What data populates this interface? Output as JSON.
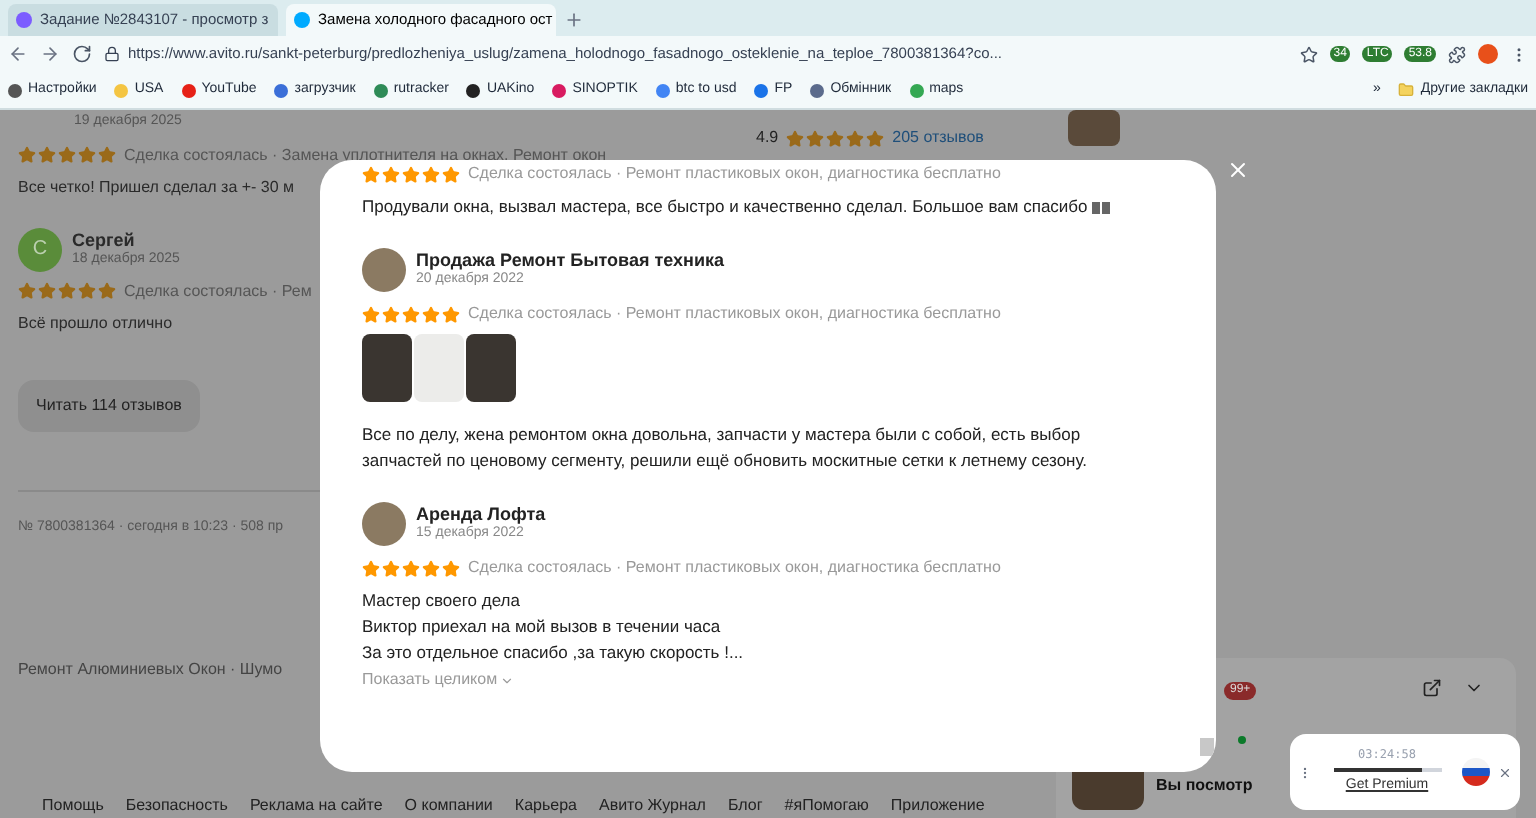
{
  "browser": {
    "tabs": [
      {
        "title": "Задание №2843107 - просмотр з",
        "selected": false
      },
      {
        "title": "Замена холодного фасадного ост",
        "selected": true
      }
    ],
    "url": "https://www.avito.ru/sankt-peterburg/predlozheniya_uslug/zamena_holodnogo_fasadnogo_osteklenie_na_teploe_7800381364?co...",
    "extension_badges": [
      "34",
      "LTC",
      "53.8"
    ],
    "bookmarks": [
      {
        "label": "Настройки",
        "color": "#555555"
      },
      {
        "label": "USA",
        "color": "#f4c542"
      },
      {
        "label": "YouTube",
        "color": "#e62117"
      },
      {
        "label": "загрузчик",
        "color": "#3b6fd8"
      },
      {
        "label": "rutracker",
        "color": "#2e8b57"
      },
      {
        "label": "UAKino",
        "color": "#222222"
      },
      {
        "label": "SINOPTIK",
        "color": "#d81b60"
      },
      {
        "label": "btc to usd",
        "color": "#4285f4"
      },
      {
        "label": "FP",
        "color": "#1a73e8"
      },
      {
        "label": "Обмінник",
        "color": "#5b6b8c"
      },
      {
        "label": "maps",
        "color": "#34a853"
      }
    ],
    "more": "»",
    "other_bookmarks": "Другие закладки"
  },
  "page": {
    "reviews": [
      {
        "date": "19 декабря 2025",
        "stars": 5,
        "deal": "Сделка состоялась · Замена уплотнителя на окнах. Ремонт окон",
        "text": "Все четко! Пришел сделал за +- 30 м"
      },
      {
        "initial": "С",
        "name": "Сергей",
        "date": "18 декабря 2025",
        "stars": 5,
        "deal": "Сделка состоялась · Рем",
        "text": "Всё прошло отлично"
      }
    ],
    "read_all_button": "Читать 114 отзывов",
    "listing_meta": "№ 7800381364 · сегодня в 10:23 · 508 пр",
    "related": "Ремонт Алюминиевых Окон · Шумо",
    "rating": {
      "score": "4.9",
      "stars": 5,
      "count": "205 отзывов"
    },
    "footer_links": [
      "Помощь",
      "Безопасность",
      "Реклама на сайте",
      "О компании",
      "Карьера",
      "Авито Журнал",
      "Блог",
      "#яПомогаю",
      "Приложение"
    ]
  },
  "chat": {
    "badge": "99+",
    "preview": "Вы посмотр"
  },
  "modal": {
    "reviews": [
      {
        "stars": 5,
        "deal": "Сделка состоялась · Ремонт пластиковых окон, диагностика бесплатно",
        "text_lines": [
          "Продували окна, вызвал мастера, все быстро и качественно сделал. Большое вам спасибо"
        ],
        "broken_emoji": true
      },
      {
        "name": "Продажа Ремонт Бытовая техника",
        "date": "20 декабря 2022",
        "stars": 5,
        "deal": "Сделка состоялась · Ремонт пластиковых окон, диагностика бесплатно",
        "photos": [
          {
            "kind": "dark"
          },
          {
            "kind": "light"
          },
          {
            "kind": "dark"
          }
        ],
        "text_lines": [
          "Все по делу, жена ремонтом окна довольна, запчасти у мастера были с собой, есть выбор запчастей по ценовому сегменту, решили ещё обновить москитные сетки к летнему сезону."
        ],
        "broken_emoji": false
      },
      {
        "name": "Аренда Лофта",
        "date": "15 декабря 2022",
        "stars": 5,
        "deal": "Сделка состоялась · Ремонт пластиковых окон, диагностика бесплатно",
        "text_lines": [
          "Мастер своего дела",
          "Виктор приехал на мой вызов в течении часа",
          "За это отдельное спасибо ,за такую скорость !..."
        ],
        "more_link": "Показать целиком",
        "broken_emoji": false
      }
    ]
  },
  "player": {
    "time": "03:24:58",
    "level": 0.82,
    "link": "Get Premium"
  }
}
